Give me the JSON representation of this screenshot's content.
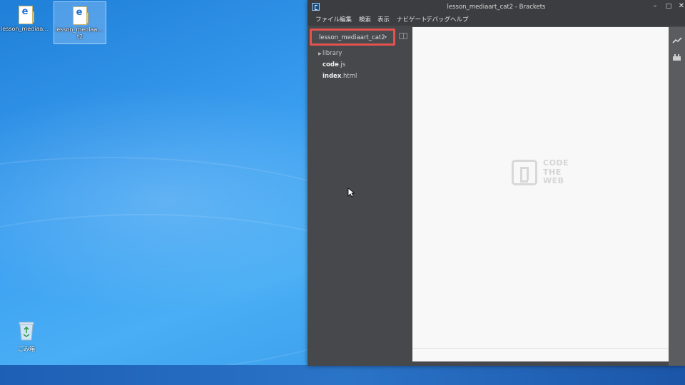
{
  "desktop": {
    "icons": [
      {
        "label": "lesson_mediaart_..."
      },
      {
        "label": "lesson_mediaart_ca",
        "label_line2": "t2"
      }
    ],
    "recycle_bin": {
      "label": "ごみ箱"
    }
  },
  "window": {
    "title": "lesson_mediaart_cat2 - Brackets",
    "controls": {
      "minimize": "–",
      "maximize": "□",
      "close": "✕"
    },
    "menu": [
      "ファイル",
      "編集",
      "検索",
      "表示",
      "ナビゲート",
      "デバッグ",
      "ヘルプ"
    ]
  },
  "sidebar": {
    "project_name": "lesson_mediaart_cat2",
    "caret": "▾",
    "tree": {
      "folder": "library",
      "files": [
        {
          "name": "code",
          "ext": ".js"
        },
        {
          "name": "index",
          "ext": ".html"
        }
      ]
    }
  },
  "editor": {
    "watermark": [
      "CODE",
      "THE",
      "WEB"
    ]
  },
  "colors": {
    "highlight": "#e4524d",
    "sidebar_bg": "#47484b",
    "editor_bg": "#f8f8f8"
  }
}
